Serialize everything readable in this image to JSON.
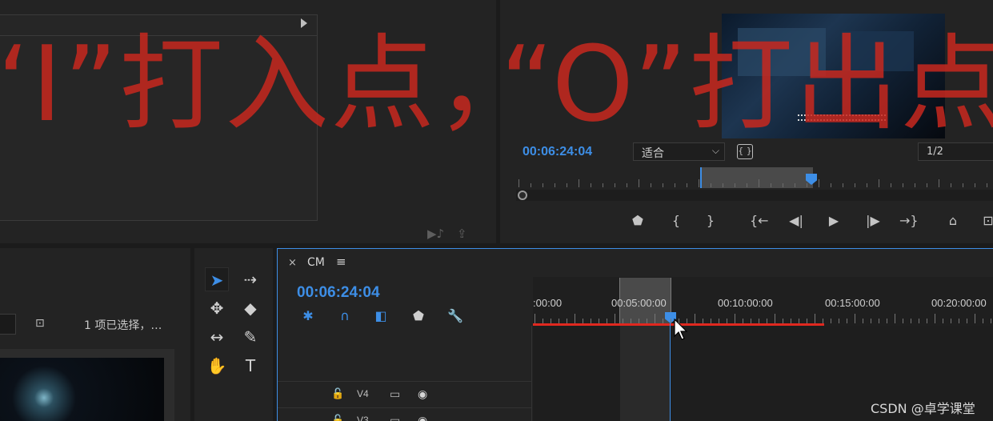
{
  "source_monitor": {
    "footer_icons": [
      "export-frame-icon",
      "insert-icon"
    ]
  },
  "program_monitor": {
    "timecode": "00:06:24:04",
    "fit_label": "适合",
    "resolution": "1/2",
    "transport": [
      "add-marker-icon",
      "mark-in-icon",
      "mark-out-icon",
      "go-to-in-icon",
      "step-back-icon",
      "play-icon",
      "step-forward-icon",
      "go-to-out-icon",
      "lift-icon",
      "extract-icon"
    ],
    "transport_glyphs": [
      "⬟",
      "{",
      "}",
      "{←",
      "◀|",
      "▶",
      "|▶",
      "→}",
      "⌂",
      "⊡"
    ]
  },
  "project_panel": {
    "selection_text": "1 项已选择，…"
  },
  "tools": {
    "items": [
      "selection-tool",
      "track-select-tool",
      "ripple-edit-tool",
      "razor-tool",
      "slip-tool",
      "pen-tool",
      "hand-tool",
      "type-tool"
    ],
    "glyphs": [
      "➤",
      "⇢",
      "✥",
      "◆",
      "↔",
      "✎",
      "✋",
      "T"
    ]
  },
  "timeline": {
    "sequence_name": "CM",
    "close_glyph": "×",
    "menu_glyph": "≡",
    "timecode": "00:06:24:04",
    "ruler_labels": [
      ":00:00",
      "00:05:00:00",
      "00:10:00:00",
      "00:15:00:00",
      "00:20:00:00"
    ],
    "tool_glyphs": [
      "✱",
      "∩",
      "◧",
      "⬟",
      "🔧"
    ],
    "tracks": [
      {
        "name": "V4",
        "lock": "🔓",
        "film": "▭",
        "eye": "◉"
      },
      {
        "name": "V3",
        "lock": "🔓",
        "film": "▭",
        "eye": "◉"
      }
    ]
  },
  "overlay": {
    "left_text": "“I”打入点，",
    "right_text": "“O”打出点"
  },
  "watermark": "CSDN @卓学课堂",
  "colors": {
    "accent_blue": "#3d8ee6",
    "in_out_red": "#e0281f",
    "overlay_red": "#c8281e",
    "panel_bg": "#232323"
  }
}
